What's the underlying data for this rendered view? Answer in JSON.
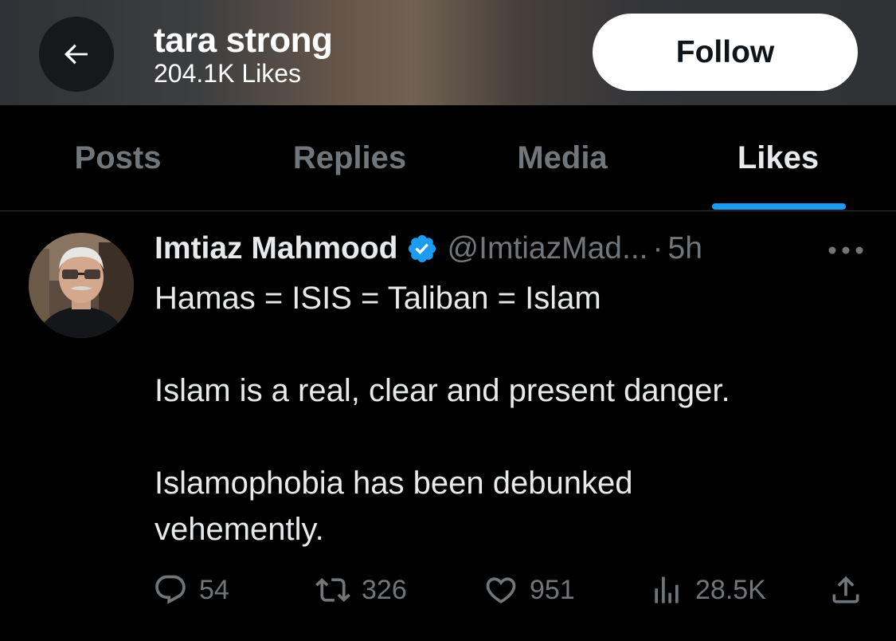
{
  "header": {
    "title": "tara strong",
    "subtitle": "204.1K Likes",
    "follow_label": "Follow",
    "back_icon": "arrow-left-icon"
  },
  "tabs": [
    {
      "label": "Posts",
      "active": false
    },
    {
      "label": "Replies",
      "active": false
    },
    {
      "label": "Media",
      "active": false
    },
    {
      "label": "Likes",
      "active": true
    }
  ],
  "tweet": {
    "author_name": "Imtiaz Mahmood",
    "verified": true,
    "handle": "@ImtiazMad...",
    "separator": "·",
    "time": "5h",
    "lines": [
      "Hamas = ISIS = Taliban = Islam",
      "Islam is a real, clear and present danger.",
      "Islamophobia has been debunked vehemently."
    ],
    "actions": {
      "replies": "54",
      "reposts": "326",
      "likes": "951",
      "views": "28.5K"
    }
  },
  "colors": {
    "background": "#000000",
    "text_primary": "#e7e9ea",
    "text_secondary": "#71767b",
    "accent": "#1d9bf0",
    "divider": "#2f3336"
  }
}
